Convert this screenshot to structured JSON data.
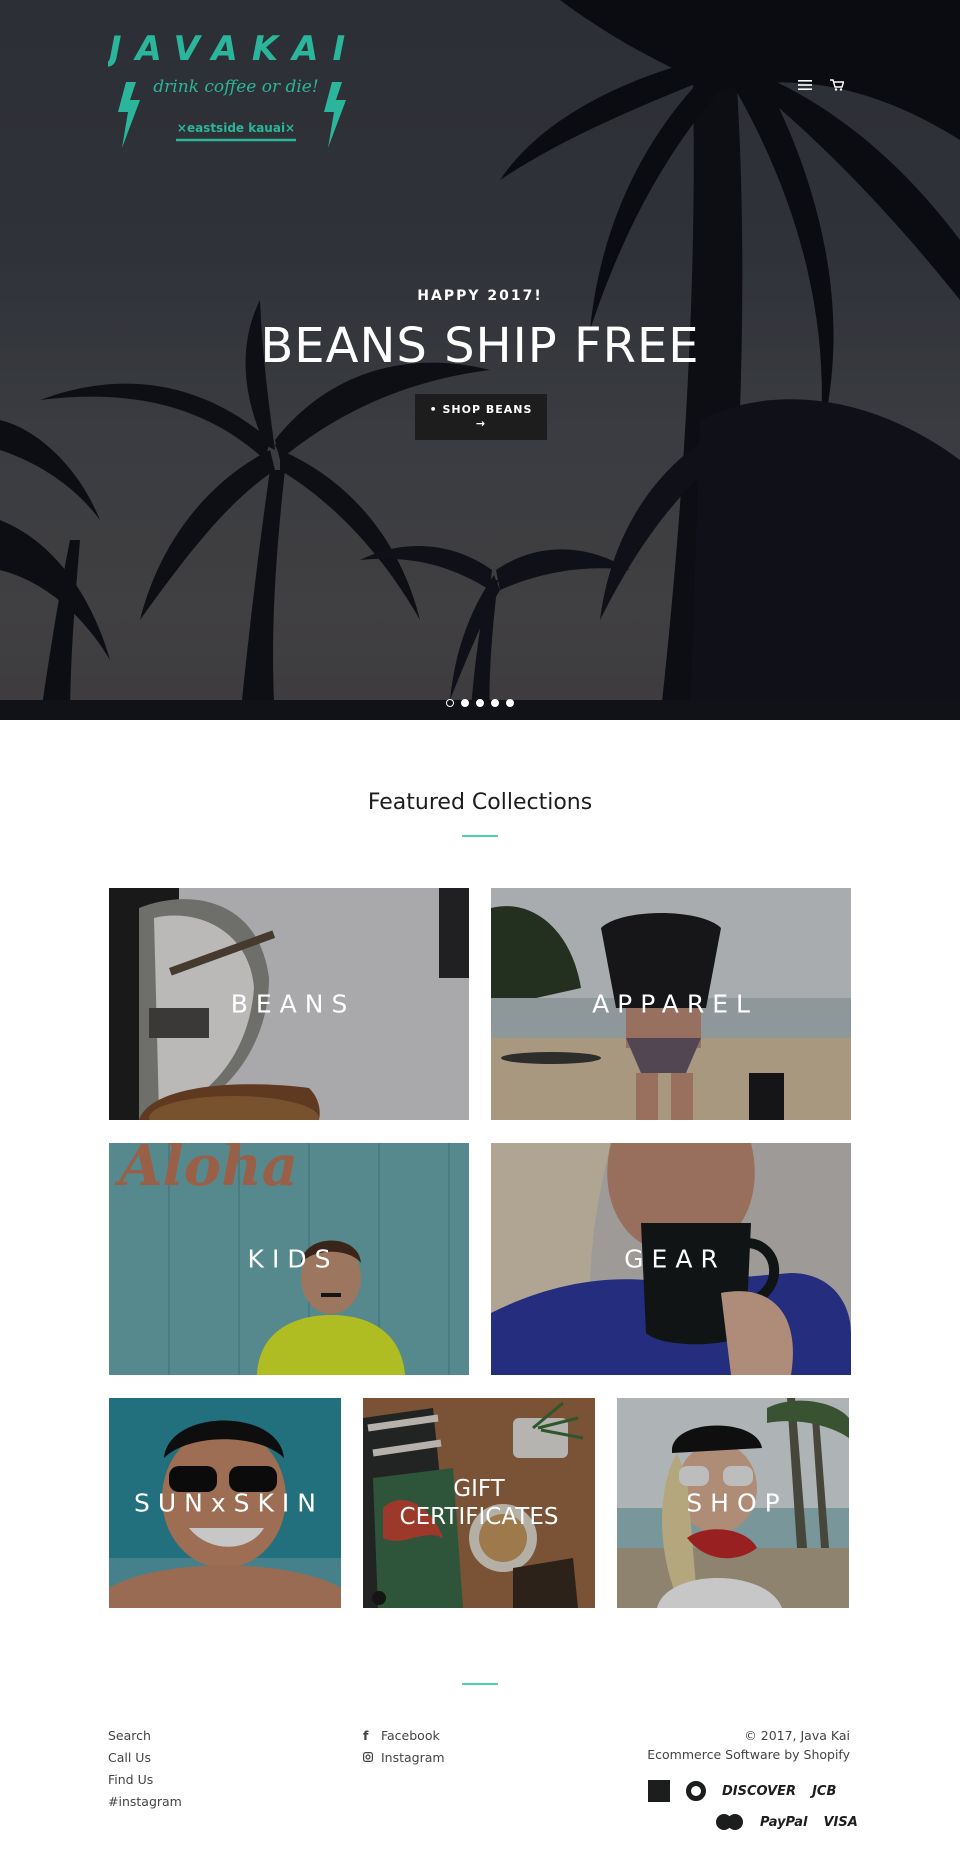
{
  "logo": {
    "brand": "JAVAKAI",
    "tagline": "drink coffee or die!",
    "location": "×eastside kauai×"
  },
  "header": {
    "menu_icon": "hamburger-icon",
    "cart_icon": "cart-icon"
  },
  "hero": {
    "subheading": "HAPPY 2017!",
    "heading": "BEANS SHIP FREE",
    "button_line1": "• SHOP BEANS",
    "button_line2": "→",
    "slides": 5,
    "active_slide": 1
  },
  "featured": {
    "title": "Featured Collections",
    "collections": [
      {
        "label": "BEANS"
      },
      {
        "label": "APPAREL"
      },
      {
        "label": "KIDS"
      },
      {
        "label": "GEAR"
      },
      {
        "label": "SUNxSKIN"
      },
      {
        "label_line1": "GIFT",
        "label_line2": "CERTIFICATES"
      },
      {
        "label": "SHOP"
      }
    ]
  },
  "footer": {
    "links": [
      "Search",
      "Call Us",
      "Find Us",
      "#instagram"
    ],
    "social": [
      {
        "icon": "facebook-icon",
        "label": "Facebook"
      },
      {
        "icon": "instagram-icon",
        "label": "Instagram"
      }
    ],
    "copyright": "© 2017, Java Kai",
    "powered_by": "Ecommerce Software by Shopify",
    "payments_row1": [
      "american-express-icon",
      "DISCOVER",
      "JCB"
    ],
    "payments_row2": [
      "master-icon",
      "PayPal",
      "VISA"
    ]
  },
  "colors": {
    "accent": "#4ecfb4",
    "logo_teal": "#2bb59a",
    "hero_button": "#1d1d1d"
  }
}
